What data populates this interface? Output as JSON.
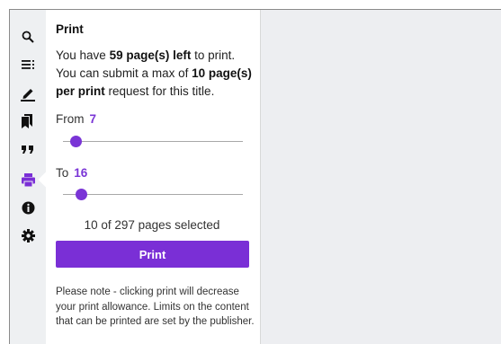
{
  "sidebar": {
    "items": [
      {
        "icon": "search-icon",
        "active": false
      },
      {
        "icon": "table-of-contents-icon",
        "active": false
      },
      {
        "icon": "annotate-pen-icon",
        "active": false
      },
      {
        "icon": "bookmarks-icon",
        "active": false
      },
      {
        "icon": "citation-quote-icon",
        "active": false
      },
      {
        "icon": "print-icon",
        "active": true
      },
      {
        "icon": "info-icon",
        "active": false
      },
      {
        "icon": "settings-gear-icon",
        "active": false
      }
    ]
  },
  "print_panel": {
    "title": "Print",
    "info": {
      "line1_prefix": "You have ",
      "pages_left": "59 page(s) left",
      "line1_suffix": " to print.",
      "line2_prefix": "You can submit a max of ",
      "max_pages": "10 page(s) per print",
      "line2_suffix": " request for this title."
    },
    "from": {
      "label": "From",
      "value": "7",
      "slider_fraction": 0.07
    },
    "to": {
      "label": "To",
      "value": "16",
      "slider_fraction": 0.1
    },
    "selected_text": "10 of 297 pages selected",
    "print_button": "Print",
    "note": "Please note - clicking print will decrease your print allowance. Limits on the content that can be printed are set by the publisher."
  },
  "colors": {
    "accent": "#7a2fd6",
    "rail_bg": "#eef0f2",
    "content_bg": "#edeef1"
  }
}
